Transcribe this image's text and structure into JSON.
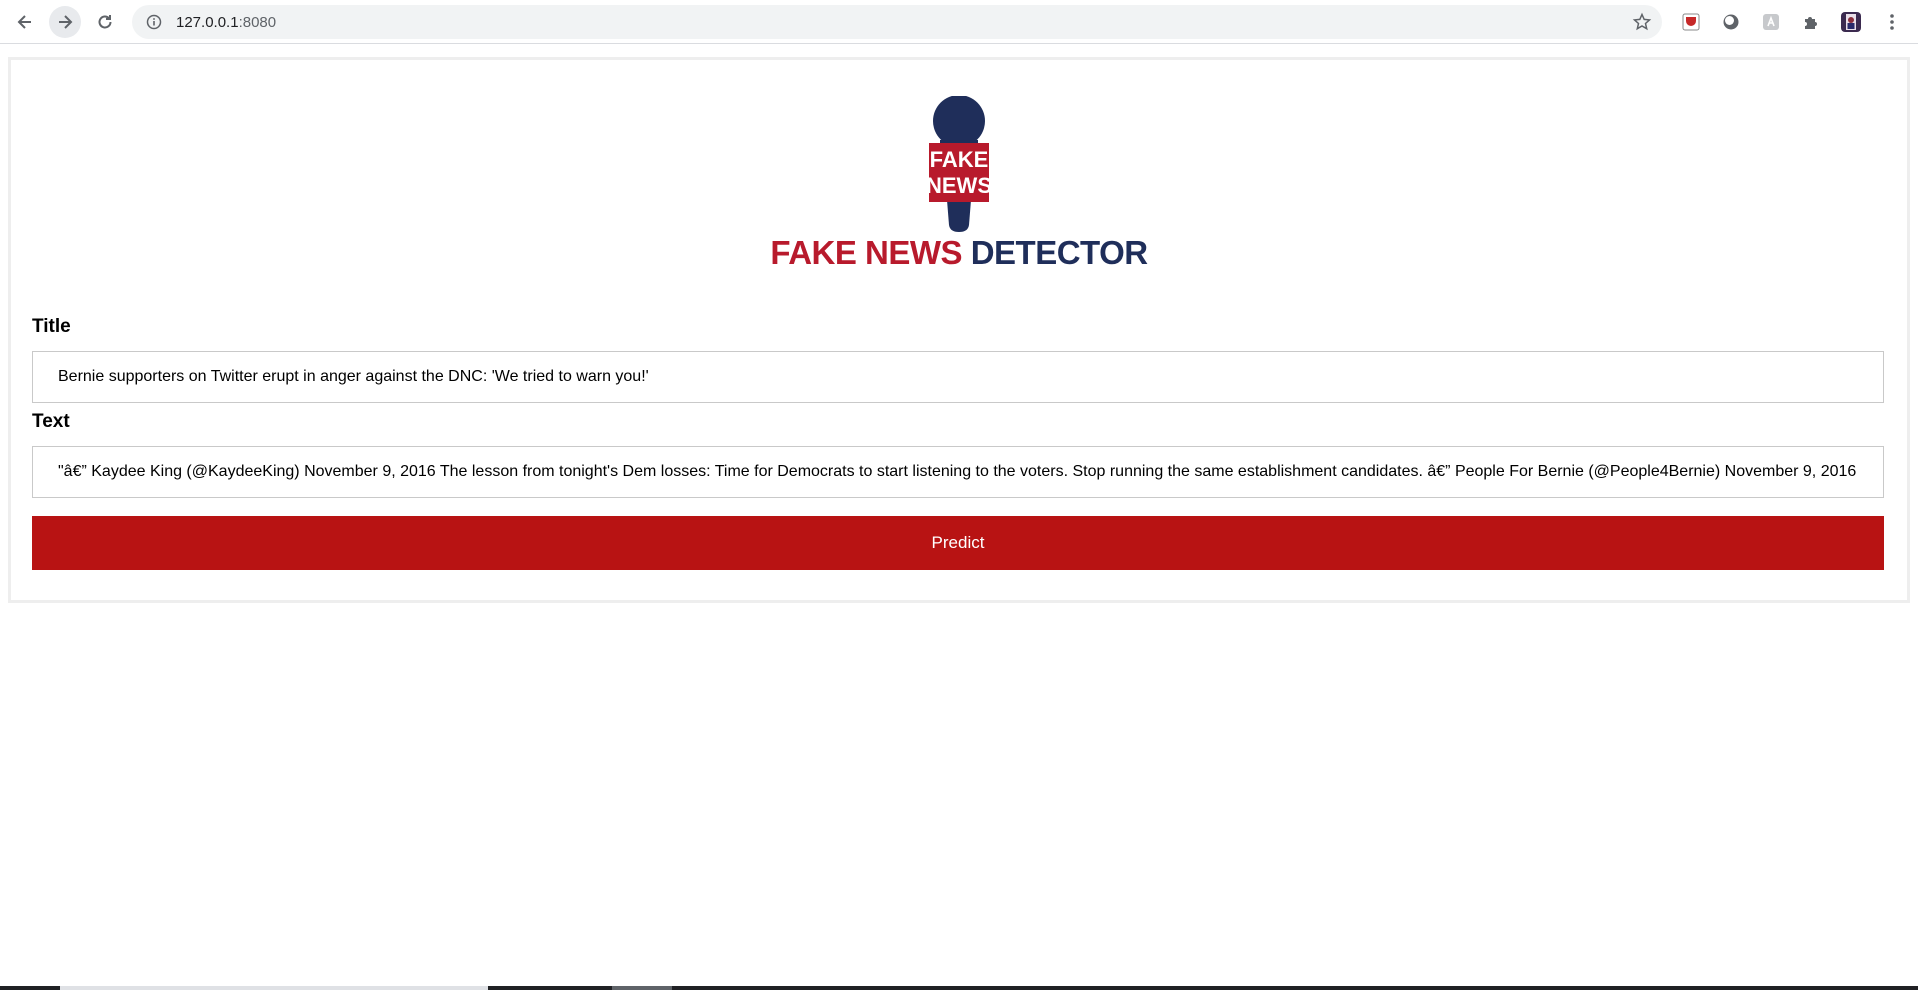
{
  "browser": {
    "url_host": "127.0.0.1",
    "url_port": ":8080"
  },
  "logo": {
    "mic_text_line1": "FAKE",
    "mic_text_line2": "NEWS",
    "brand_part1": "FAKE NEWS",
    "brand_part2": "DETECTOR"
  },
  "form": {
    "title_label": "Title",
    "title_value": "Bernie supporters on Twitter erupt in anger against the DNC: 'We tried to warn you!'",
    "text_label": "Text",
    "text_value": "\"â€” Kaydee King (@KaydeeKing) November 9, 2016 The lesson from tonight's Dem losses: Time for Democrats to start listening to the voters. Stop running the same establishment candidates.  â€” People For Bernie (@People4Bernie) November 9, 2016",
    "predict_label": "Predict"
  },
  "colors": {
    "brand_red": "#b81a2c",
    "brand_blue": "#1f2e5a",
    "button_red": "#b81313"
  },
  "icons": [
    "back-arrow-icon",
    "forward-arrow-icon",
    "reload-icon",
    "info-icon",
    "star-icon",
    "extension-icon",
    "puzzle-icon",
    "avatar",
    "menu-dots-icon"
  ]
}
